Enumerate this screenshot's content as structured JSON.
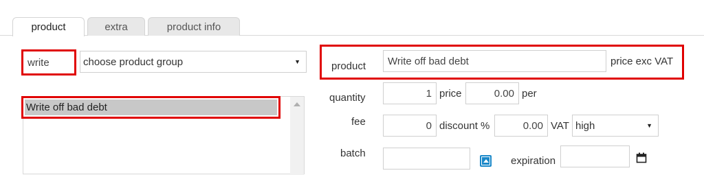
{
  "tabs": [
    {
      "label": "product",
      "active": true
    },
    {
      "label": "extra",
      "active": false
    },
    {
      "label": "product info",
      "active": false
    }
  ],
  "left": {
    "write_value": "write",
    "group_select": {
      "value": "choose product group"
    },
    "list_items": [
      "Write off bad debt"
    ]
  },
  "right": {
    "product_label": "product",
    "product_value": "Write off bad debt",
    "price_mode": "price exc VAT",
    "quantity_label": "quantity",
    "quantity_value": "1",
    "price_label": "price",
    "price_value": "0.00",
    "per_label": "per",
    "fee_label": "fee",
    "fee_value": "0",
    "discount_label": "discount %",
    "discount_value": "0.00",
    "vat_label": "VAT",
    "vat_select": {
      "value": "high"
    },
    "batch_label": "batch",
    "batch_value": "",
    "expiration_label": "expiration",
    "expiration_value": ""
  },
  "colors": {
    "highlight": "#e00000",
    "selected_row": "#c8c8c8",
    "accent_icon": "#1a88c9"
  },
  "icons": {
    "expand": "expand-up-icon",
    "calendar": "calendar-icon"
  }
}
